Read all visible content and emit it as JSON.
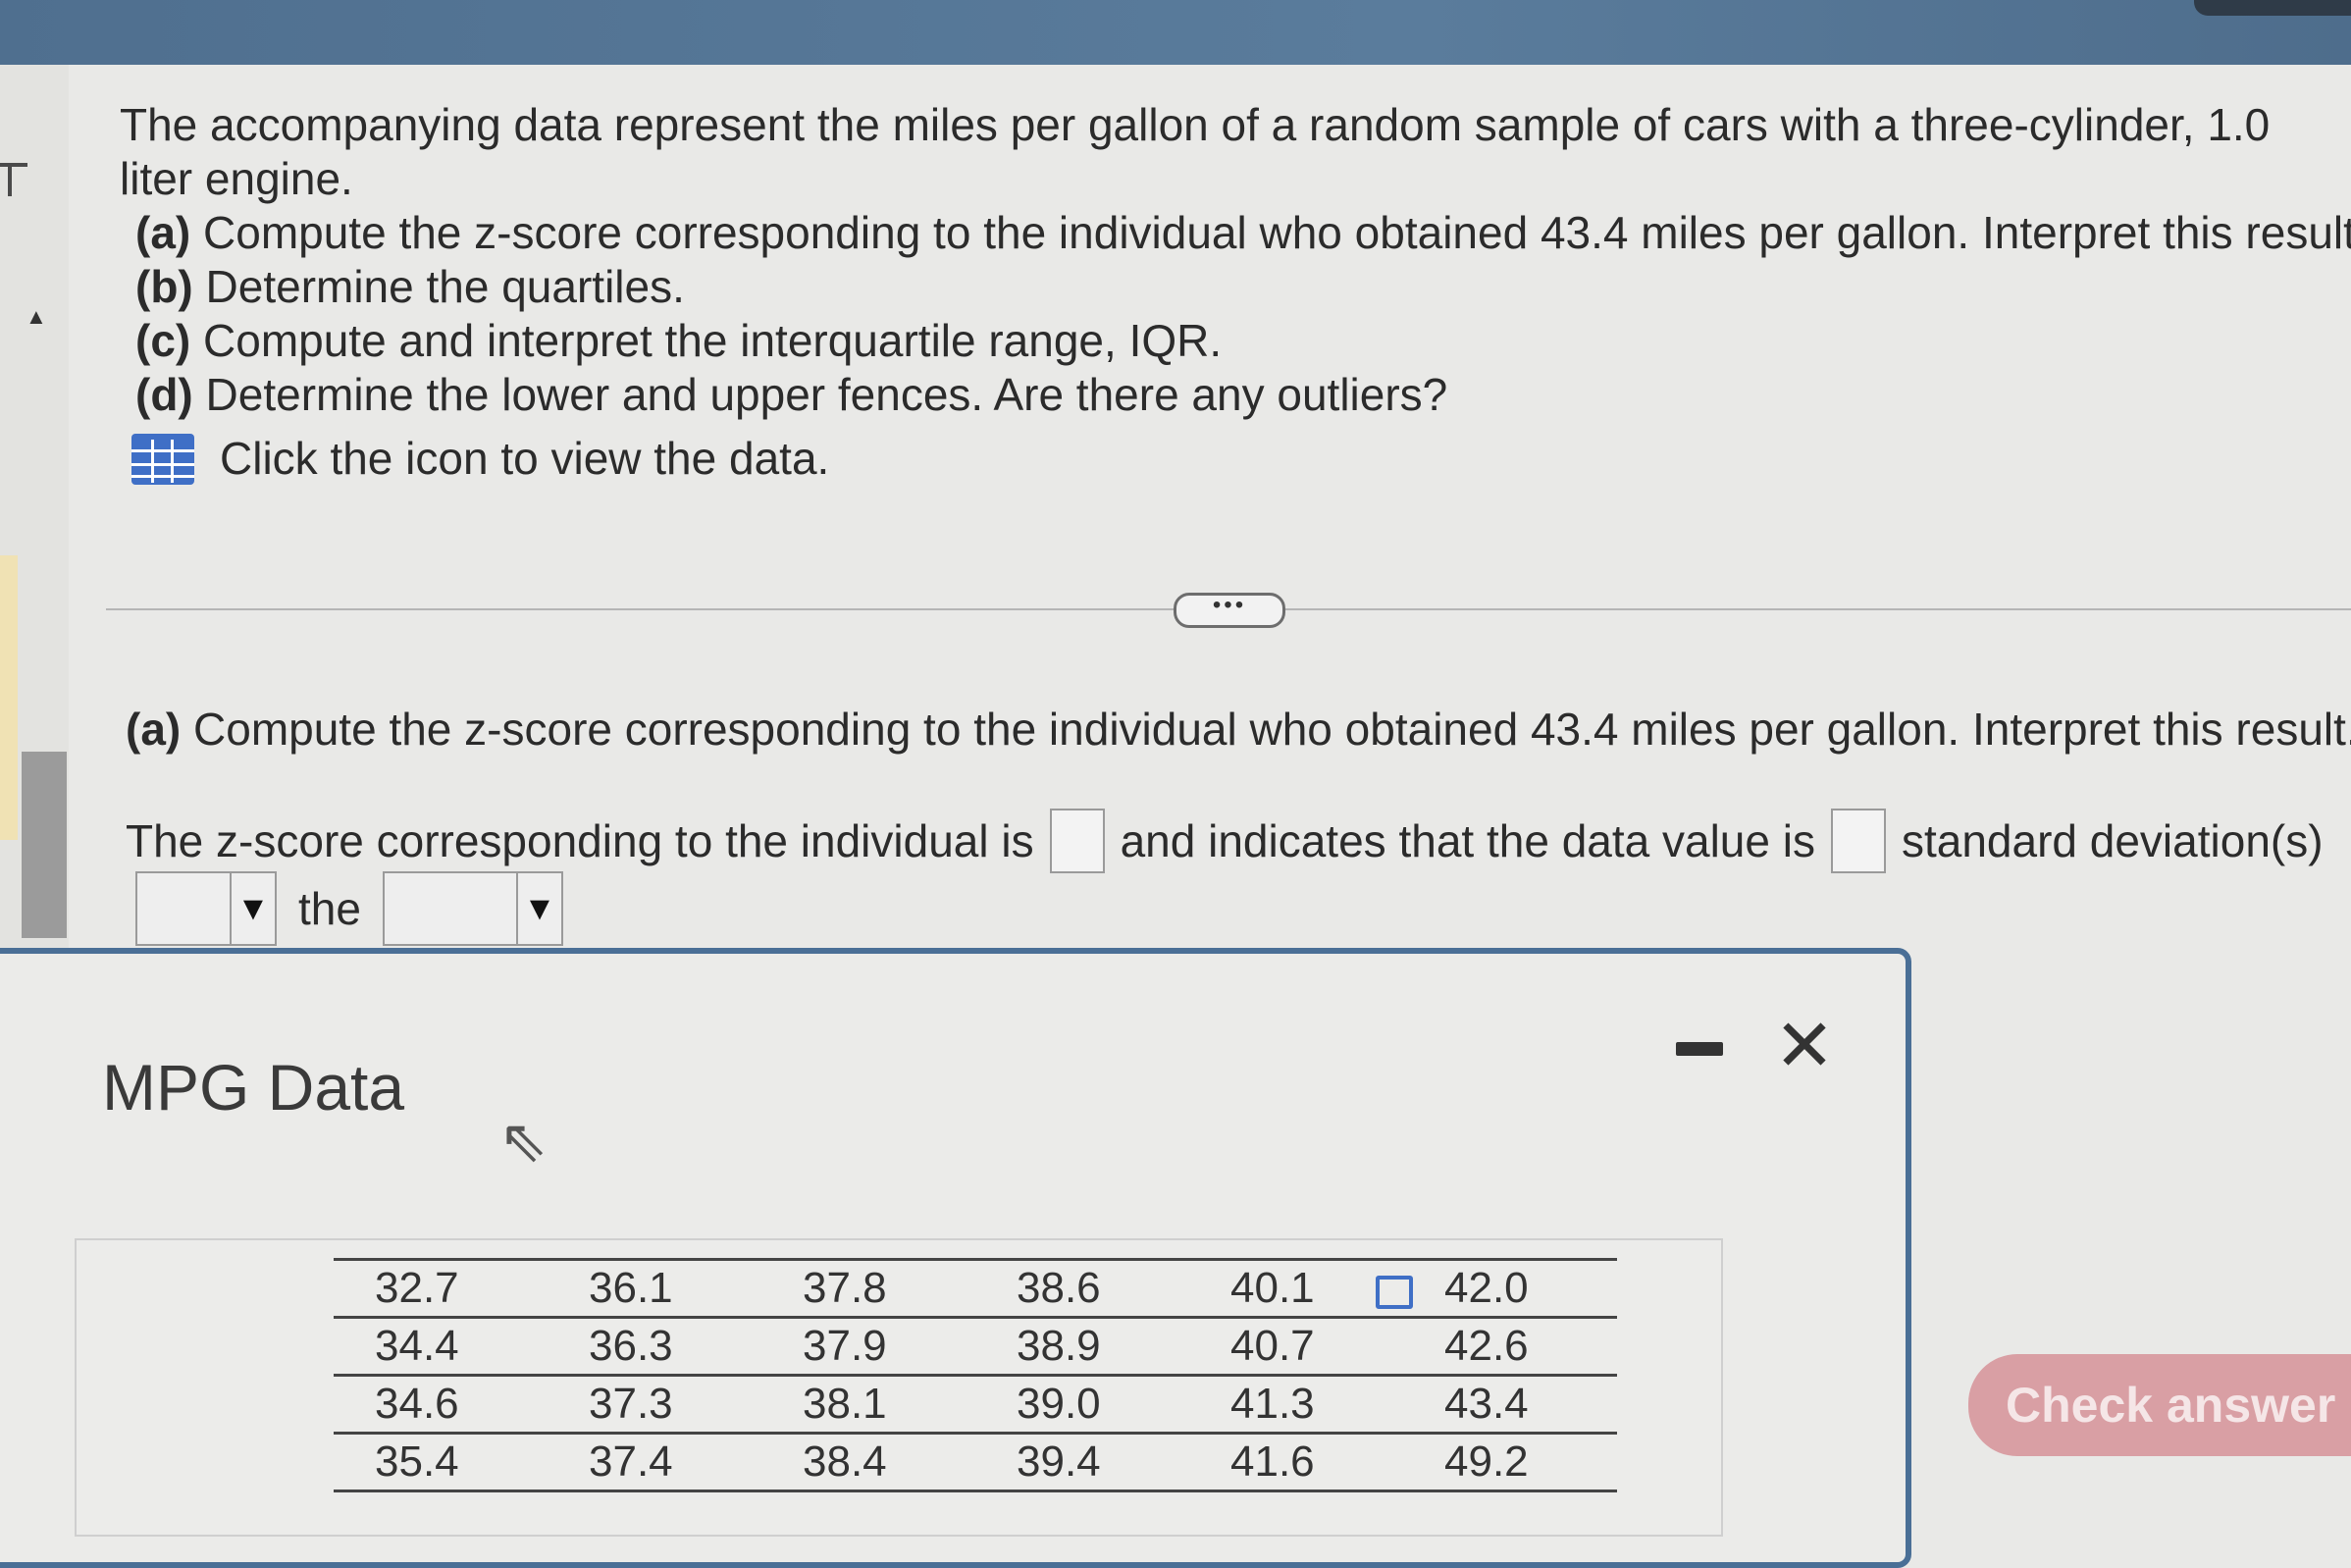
{
  "question": {
    "intro": "The accompanying data represent the miles per gallon of a random sample of cars with a three-cylinder, 1.0 liter engine.",
    "parts": [
      {
        "label": "(a)",
        "text": "Compute the z-score corresponding to the individual who obtained 43.4 miles per gallon. Interpret this result."
      },
      {
        "label": "(b)",
        "text": "Determine the quartiles."
      },
      {
        "label": "(c)",
        "text": "Compute and interpret the interquartile range, IQR."
      },
      {
        "label": "(d)",
        "text": "Determine the lower and upper fences. Are there any outliers?"
      }
    ],
    "data_link": "Click the icon to view the data.",
    "data_icon": "table-grid-icon"
  },
  "divider": {
    "dots": "•••"
  },
  "part_a": {
    "title_label": "(a)",
    "title_text": "Compute the z-score corresponding to the individual who obtained 43.4 miles per gallon. Interpret this result.",
    "sentence_1": "The z-score corresponding to the individual is",
    "sentence_2": "and indicates that the data value is",
    "sentence_3": "standard deviation(s)",
    "word_the": "the",
    "zscore_value": "",
    "sd_value": "",
    "dropdown_1_selected": "",
    "dropdown_2_selected": ""
  },
  "popup": {
    "title": "MPG Data",
    "minimize_icon": "minimize-icon",
    "close_icon": "close-icon",
    "copy_icon": "copy-icon",
    "table": [
      [
        "32.7",
        "36.1",
        "37.8",
        "38.6",
        "40.1",
        "42.0"
      ],
      [
        "34.4",
        "36.3",
        "37.9",
        "38.9",
        "40.7",
        "42.6"
      ],
      [
        "34.6",
        "37.3",
        "38.1",
        "39.0",
        "41.3",
        "43.4"
      ],
      [
        "35.4",
        "37.4",
        "38.4",
        "39.4",
        "41.6",
        "49.2"
      ]
    ]
  },
  "footer": {
    "check_answer": "Check answer"
  },
  "colors": {
    "header": "#5a7c9c",
    "accent": "#3f6fc6",
    "check_button": "#d99fa4"
  }
}
